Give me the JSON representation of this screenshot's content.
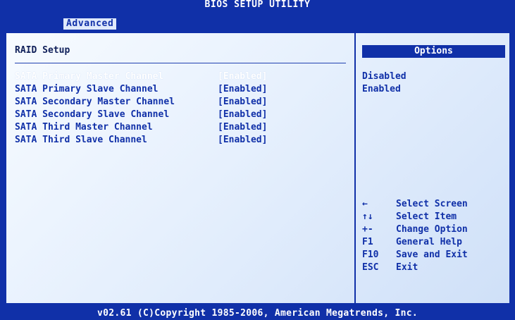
{
  "title": "BIOS SETUP UTILITY",
  "menu": {
    "active_tab": "Advanced"
  },
  "panel": {
    "section_title": "RAID Setup",
    "settings": [
      {
        "label": "SATA Primary Master Channel",
        "value": "[Enabled]",
        "selected": true
      },
      {
        "label": "SATA Primary Slave Channel",
        "value": "[Enabled]"
      },
      {
        "label": "SATA Secondary Master Channel",
        "value": "[Enabled]"
      },
      {
        "label": "SATA Secondary Slave Channel",
        "value": "[Enabled]"
      },
      {
        "label": "SATA Third Master Channel",
        "value": "[Enabled]"
      },
      {
        "label": "SATA Third Slave Channel",
        "value": "[Enabled]"
      }
    ]
  },
  "help": {
    "header": "Options",
    "options": [
      "Disabled",
      "Enabled"
    ],
    "keys": [
      {
        "key": "←",
        "desc": "Select Screen",
        "icon": "arrow-left-icon"
      },
      {
        "key": "↑↓",
        "desc": "Select Item",
        "icon": "arrow-up-down-icon"
      },
      {
        "key": "+-",
        "desc": "Change Option",
        "icon": "plus-minus-icon"
      },
      {
        "key": "F1",
        "desc": "General Help"
      },
      {
        "key": "F10",
        "desc": "Save and Exit"
      },
      {
        "key": "ESC",
        "desc": "Exit"
      }
    ]
  },
  "footer": "v02.61 (C)Copyright 1985-2006, American Megatrends, Inc.",
  "colors": {
    "bios_blue": "#1030a8",
    "panel_bg": "#e6f0fd",
    "highlight_text": "#ffffff"
  }
}
